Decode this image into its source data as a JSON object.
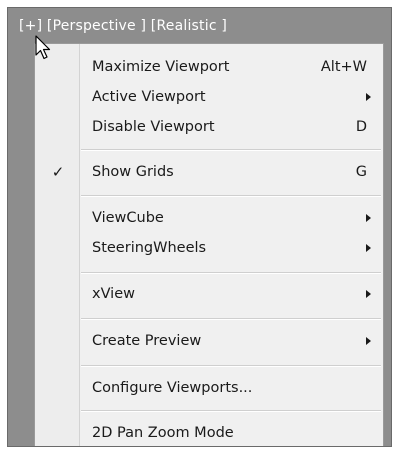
{
  "viewport": {
    "label": "[+] [Perspective ] [Realistic ]"
  },
  "menu": {
    "items": [
      {
        "label": "Maximize Viewport",
        "shortcut": "Alt+W"
      },
      {
        "label": "Active Viewport",
        "submenu": true
      },
      {
        "label": "Disable Viewport",
        "shortcut": "D"
      },
      {
        "label": "Show Grids",
        "shortcut": "G",
        "checked": true,
        "check_glyph": "✓"
      },
      {
        "label": "ViewCube",
        "submenu": true
      },
      {
        "label": "SteeringWheels",
        "submenu": true
      },
      {
        "label": "xView",
        "submenu": true
      },
      {
        "label": "Create Preview",
        "submenu": true
      },
      {
        "label": "Configure Viewports..."
      },
      {
        "label": "2D Pan Zoom Mode"
      }
    ]
  },
  "colors": {
    "viewport_bg": "#8d8d8d",
    "menu_bg": "#f0f0f0",
    "text": "#1a1a1a"
  },
  "icons": {
    "cursor": "arrow-pointer-icon",
    "check": "checkmark-icon",
    "submenu": "submenu-arrow-icon"
  }
}
